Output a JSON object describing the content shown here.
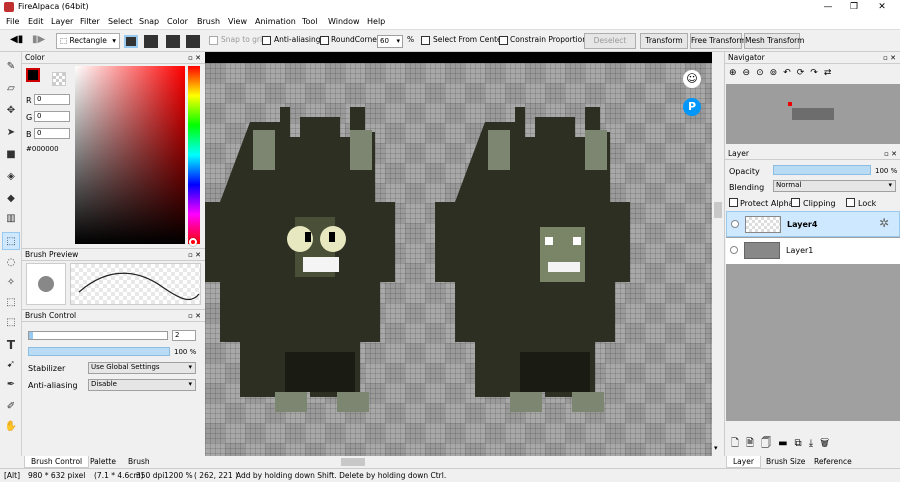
{
  "app": {
    "title": "FireAlpaca (64bit)"
  },
  "window_controls": [
    "—",
    "❐",
    "✕"
  ],
  "menu": [
    "File",
    "Edit",
    "Layer",
    "Filter",
    "Select",
    "Snap",
    "Color",
    "Brush",
    "View",
    "Animation",
    "Tool",
    "Window",
    "Help"
  ],
  "toolbar": {
    "shape_select": "Rectangle",
    "snap_to_grid": "Snap to grid",
    "anti_aliasing": "Anti-aliasing",
    "round_corner": "RoundCorner",
    "round_value": "60",
    "percent": "%",
    "select_from_center": "Select From Center",
    "constrain": "Constrain Proportions",
    "deselect": "Deselect",
    "transform": "Transform",
    "free_transform": "Free Transform",
    "mesh_transform": "Mesh Transform"
  },
  "color_panel": {
    "title": "Color",
    "r_label": "R",
    "r": "0",
    "g_label": "G",
    "g": "0",
    "b_label": "B",
    "b": "0",
    "hex": "#000000",
    "primary": "#000000"
  },
  "brush_preview": {
    "title": "Brush Preview"
  },
  "brush_control": {
    "title": "Brush Control",
    "size": "2",
    "opacity": "100 %",
    "stabilizer_label": "Stabilizer",
    "stabilizer_value": "Use Global Settings",
    "aa_label": "Anti-aliasing",
    "aa_value": "Disable"
  },
  "left_tabs": [
    "Brush Control",
    "Palette",
    "Brush"
  ],
  "navigator": {
    "title": "Navigator"
  },
  "layer_panel": {
    "title": "Layer",
    "opacity_label": "Opacity",
    "opacity_value": "100 %",
    "opacity_fraction": 1.0,
    "blending_label": "Blending",
    "blending_value": "Normal",
    "protect_alpha": "Protect Alpha",
    "clipping": "Clipping",
    "lock": "Lock",
    "layers": [
      {
        "name": "Layer4",
        "selected": true
      },
      {
        "name": "Layer1",
        "selected": false
      }
    ]
  },
  "right_tabs": [
    "Layer",
    "Brush Size",
    "Reference"
  ],
  "status": {
    "mode": "[Alt]",
    "size": "980 * 632 pixel",
    "cm": "(7.1 * 4.6cm)",
    "dpi": "350 dpi",
    "zoom": "1200 %",
    "coords": "( 262, 221 )",
    "hint": "Add by holding down Shift. Delete by holding down Ctrl."
  },
  "colors": {
    "accent": "#99c9ef",
    "selected_layer": "#cde8ff",
    "canvas_bg": "#9a9a9a",
    "hue_red": "#ff0000"
  }
}
